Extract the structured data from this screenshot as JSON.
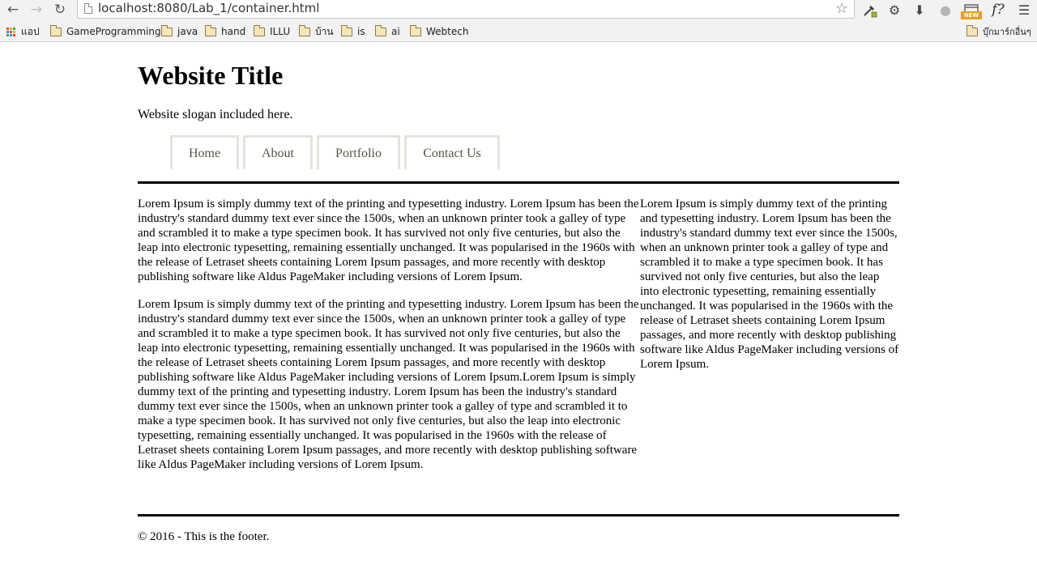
{
  "browser": {
    "url": "localhost:8080/Lab_1/container.html",
    "extensions": {
      "new_badge": "NEW",
      "fx_label": "f?"
    },
    "bookmarks": [
      {
        "label": "แอป",
        "icon": "apps-icon"
      },
      {
        "label": "GameProgramming",
        "icon": "folder-icon"
      },
      {
        "label": "java",
        "icon": "folder-icon"
      },
      {
        "label": "hand",
        "icon": "folder-icon"
      },
      {
        "label": "ILLU",
        "icon": "folder-icon"
      },
      {
        "label": "บ้าน",
        "icon": "folder-icon"
      },
      {
        "label": "is",
        "icon": "folder-icon"
      },
      {
        "label": "ai",
        "icon": "folder-icon"
      },
      {
        "label": "Webtech",
        "icon": "folder-icon"
      }
    ],
    "other_bookmarks": "บุ๊กมาร์กอื่นๆ",
    "icons": {
      "back": "back-arrow-icon",
      "forward": "forward-arrow-icon",
      "reload": "reload-icon",
      "star": "star-icon",
      "menu": "hamburger-menu-icon"
    }
  },
  "site": {
    "title": "Website Title",
    "slogan": "Website slogan included here.",
    "nav": [
      "Home",
      "About",
      "Portfolio",
      "Contact Us"
    ],
    "main": [
      "Lorem Ipsum is simply dummy text of the printing and typesetting industry. Lorem Ipsum has been the industry's standard dummy text ever since the 1500s, when an unknown printer took a galley of type and scrambled it to make a type specimen book. It has survived not only five centuries, but also the leap into electronic typesetting, remaining essentially unchanged. It was popularised in the 1960s with the release of Letraset sheets containing Lorem Ipsum passages, and more recently with desktop publishing software like Aldus PageMaker including versions of Lorem Ipsum.",
      "Lorem Ipsum is simply dummy text of the printing and typesetting industry. Lorem Ipsum has been the industry's standard dummy text ever since the 1500s, when an unknown printer took a galley of type and scrambled it to make a type specimen book. It has survived not only five centuries, but also the leap into electronic typesetting, remaining essentially unchanged. It was popularised in the 1960s with the release of Letraset sheets containing Lorem Ipsum passages, and more recently with desktop publishing software like Aldus PageMaker including versions of Lorem Ipsum.Lorem Ipsum is simply dummy text of the printing and typesetting industry. Lorem Ipsum has been the industry's standard dummy text ever since the 1500s, when an unknown printer took a galley of type and scrambled it to make a type specimen book. It has survived not only five centuries, but also the leap into electronic typesetting, remaining essentially unchanged. It was popularised in the 1960s with the release of Letraset sheets containing Lorem Ipsum passages, and more recently with desktop publishing software like Aldus PageMaker including versions of Lorem Ipsum."
    ],
    "sidebar": "Lorem Ipsum is simply dummy text of the printing and typesetting industry. Lorem Ipsum has been the industry's standard dummy text ever since the 1500s, when an unknown printer took a galley of type and scrambled it to make a type specimen book. It has survived not only five centuries, but also the leap into electronic typesetting, remaining essentially unchanged. It was popularised in the 1960s with the release of Letraset sheets containing Lorem Ipsum passages, and more recently with desktop publishing software like Aldus PageMaker including versions of Lorem Ipsum.",
    "footer": "© 2016 - This is the footer."
  },
  "colors": {
    "nav_border": "#e4e4de",
    "nav_text": "#555544",
    "rule": "#000000",
    "chrome_bg": "#f2f2f2"
  }
}
